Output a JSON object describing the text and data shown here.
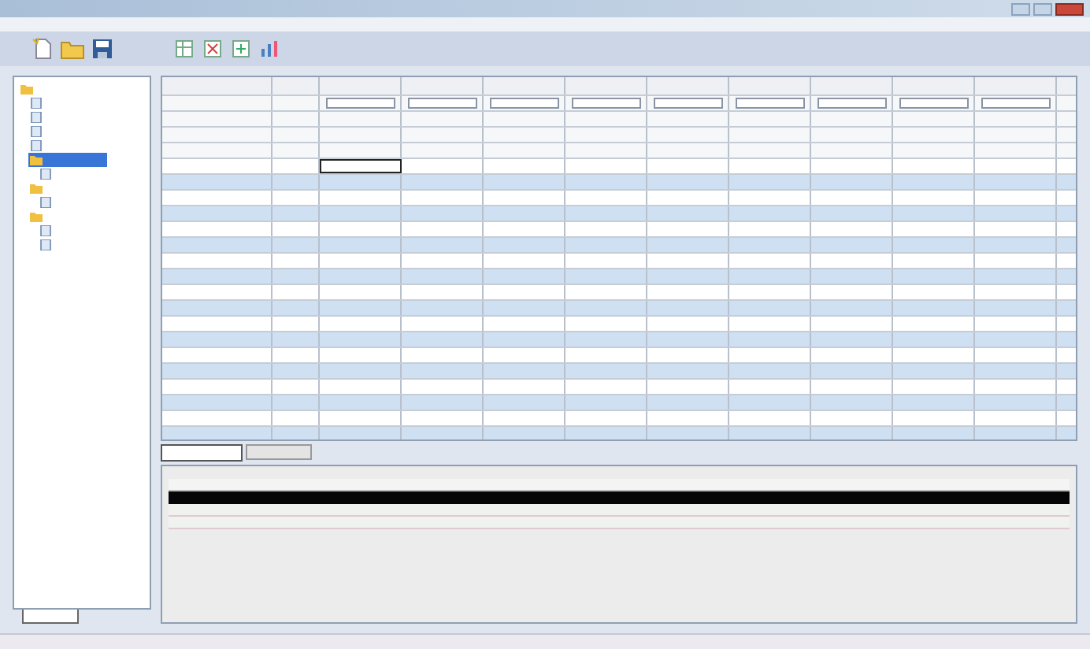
{
  "tree": {
    "items": [
      {
        "kind": "folder",
        "selected": false,
        "children": [
          {
            "kind": "doc",
            "selected": false
          },
          {
            "kind": "doc",
            "selected": false
          },
          {
            "kind": "doc",
            "selected": false
          },
          {
            "kind": "doc",
            "selected": false
          },
          {
            "kind": "folder",
            "selected": true,
            "children": [
              {
                "kind": "doc",
                "selected": false
              }
            ]
          },
          {
            "kind": "folder",
            "selected": false,
            "children": [
              {
                "kind": "doc",
                "selected": false
              }
            ]
          },
          {
            "kind": "folder",
            "selected": false,
            "children": [
              {
                "kind": "doc",
                "selected": false
              },
              {
                "kind": "doc",
                "selected": false
              }
            ]
          }
        ]
      }
    ]
  },
  "sidebar_tabs": [
    {
      "selected": true
    }
  ],
  "grid": {
    "rows": [
      {
        "selected": true
      },
      {
        "selected": false
      },
      {
        "selected": false
      },
      {
        "selected": false
      },
      {
        "selected": false
      },
      {
        "selected": false
      },
      {
        "selected": false
      },
      {
        "selected": false
      },
      {
        "selected": false
      },
      {
        "selected": false
      },
      {
        "selected": false
      },
      {
        "selected": false
      },
      {
        "selected": false
      },
      {
        "selected": false
      },
      {
        "selected": false
      },
      {
        "selected": false
      },
      {
        "selected": false
      },
      {
        "selected": false
      }
    ]
  },
  "bottom_tabs": [
    {
      "selected": true
    },
    {
      "selected": false
    }
  ],
  "details_table": {
    "rows": [
      {
        "selected": true
      },
      {
        "selected": false
      },
      {
        "selected": false
      }
    ]
  }
}
